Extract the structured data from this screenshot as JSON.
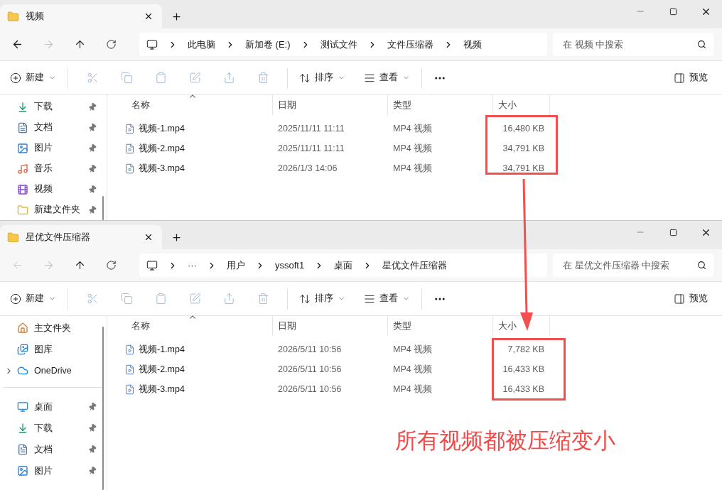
{
  "windows": [
    {
      "tab": {
        "title": "视频"
      },
      "nav": {
        "back_disabled": false,
        "forward_disabled": true
      },
      "breadcrumb": [
        "此电脑",
        "新加卷 (E:)",
        "测试文件",
        "文件压缩器",
        "视频"
      ],
      "search": {
        "placeholder": "在 视频 中搜索"
      },
      "toolbar": {
        "new": "新建",
        "actions": [
          {
            "kind": "cut",
            "disabled": true
          },
          {
            "kind": "copy",
            "disabled": true
          },
          {
            "kind": "paste",
            "disabled": true
          },
          {
            "kind": "rename",
            "disabled": true
          },
          {
            "kind": "share",
            "disabled": true
          },
          {
            "kind": "delete",
            "disabled": true
          }
        ],
        "sort": "排序",
        "view": "查看",
        "preview": "预览"
      },
      "sidebar": {
        "groups": [
          [
            {
              "label": "下载",
              "kind": "download",
              "pinned": true,
              "expandable": false
            },
            {
              "label": "文档",
              "kind": "document",
              "pinned": true,
              "expandable": false
            },
            {
              "label": "图片",
              "kind": "picture",
              "pinned": true,
              "expandable": false
            },
            {
              "label": "音乐",
              "kind": "music",
              "pinned": true,
              "expandable": false
            },
            {
              "label": "视频",
              "kind": "video",
              "pinned": true,
              "expandable": false
            },
            {
              "label": "新建文件夹",
              "kind": "folder",
              "pinned": true,
              "expandable": false
            }
          ]
        ]
      },
      "columns": [
        {
          "label": "名称",
          "sorted": true
        },
        {
          "label": "日期",
          "sorted": false
        },
        {
          "label": "类型",
          "sorted": false
        },
        {
          "label": "大小",
          "sorted": false
        }
      ],
      "files": [
        {
          "name": "视频-1.mp4",
          "date": "2025/11/11 11:11",
          "type": "MP4 视频",
          "size": "16,480 KB"
        },
        {
          "name": "视频-2.mp4",
          "date": "2025/11/11 11:11",
          "type": "MP4 视频",
          "size": "34,791 KB"
        },
        {
          "name": "视频-3.mp4",
          "date": "2026/1/3 14:06",
          "type": "MP4 视频",
          "size": "34,791 KB"
        }
      ],
      "size_highlighted": true
    },
    {
      "tab": {
        "title": "星优文件压缩器"
      },
      "nav": {
        "back_disabled": true,
        "forward_disabled": true
      },
      "breadcrumb": [
        "···",
        "用户",
        "yssoft1",
        "桌面",
        "星优文件压缩器"
      ],
      "search": {
        "placeholder": "在 星优文件压缩器 中搜索"
      },
      "toolbar": {
        "new": "新建",
        "actions": [
          {
            "kind": "cut",
            "disabled": true
          },
          {
            "kind": "copy",
            "disabled": true
          },
          {
            "kind": "paste",
            "disabled": true
          },
          {
            "kind": "rename",
            "disabled": true
          },
          {
            "kind": "share",
            "disabled": true
          },
          {
            "kind": "delete",
            "disabled": true
          }
        ],
        "sort": "排序",
        "view": "查看",
        "preview": "预览"
      },
      "sidebar": {
        "groups": [
          [
            {
              "label": "主文件夹",
              "kind": "home",
              "pinned": false,
              "expandable": false
            },
            {
              "label": "图库",
              "kind": "gallery",
              "pinned": false,
              "expandable": false
            },
            {
              "label": "OneDrive",
              "kind": "cloud",
              "pinned": false,
              "expandable": true
            }
          ],
          [
            {
              "label": "桌面",
              "kind": "desktop",
              "pinned": true,
              "expandable": false
            },
            {
              "label": "下载",
              "kind": "download",
              "pinned": true,
              "expandable": false
            },
            {
              "label": "文档",
              "kind": "document",
              "pinned": true,
              "expandable": false
            },
            {
              "label": "图片",
              "kind": "picture",
              "pinned": true,
              "expandable": false
            }
          ]
        ]
      },
      "columns": [
        {
          "label": "名称",
          "sorted": true
        },
        {
          "label": "日期",
          "sorted": false
        },
        {
          "label": "类型",
          "sorted": false
        },
        {
          "label": "大小",
          "sorted": false
        }
      ],
      "files": [
        {
          "name": "视频-1.mp4",
          "date": "2026/5/11 10:56",
          "type": "MP4 视频",
          "size": "7,782 KB"
        },
        {
          "name": "视频-2.mp4",
          "date": "2026/5/11 10:56",
          "type": "MP4 视频",
          "size": "16,433 KB"
        },
        {
          "name": "视频-3.mp4",
          "date": "2026/5/11 10:56",
          "type": "MP4 视频",
          "size": "16,433 KB"
        }
      ],
      "size_highlighted": true
    }
  ],
  "annotation": {
    "text": "所有视频都被压缩变小"
  }
}
